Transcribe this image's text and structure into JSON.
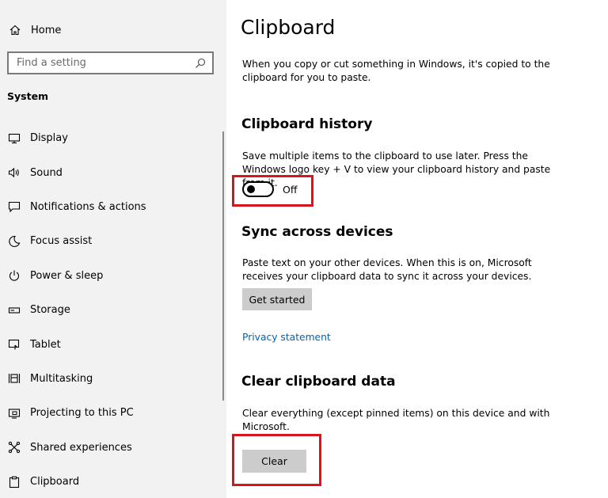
{
  "sidebar": {
    "home_label": "Home",
    "search_placeholder": "Find a setting",
    "section_label": "System",
    "items": [
      {
        "label": "Display",
        "icon": "display-icon"
      },
      {
        "label": "Sound",
        "icon": "speaker-icon"
      },
      {
        "label": "Notifications & actions",
        "icon": "notification-icon"
      },
      {
        "label": "Focus assist",
        "icon": "moon-icon"
      },
      {
        "label": "Power & sleep",
        "icon": "power-icon"
      },
      {
        "label": "Storage",
        "icon": "storage-icon"
      },
      {
        "label": "Tablet",
        "icon": "tablet-icon"
      },
      {
        "label": "Multitasking",
        "icon": "multitasking-icon"
      },
      {
        "label": "Projecting to this PC",
        "icon": "projecting-icon"
      },
      {
        "label": "Shared experiences",
        "icon": "shared-icon"
      },
      {
        "label": "Clipboard",
        "icon": "clipboard-icon"
      }
    ]
  },
  "main": {
    "title": "Clipboard",
    "intro": "When you copy or cut something in Windows, it's copied to the clipboard for you to paste.",
    "history": {
      "heading": "Clipboard history",
      "description": "Save multiple items to the clipboard to use later. Press the Windows logo key + V to view your clipboard history and paste from it.",
      "toggle_state": "Off"
    },
    "sync": {
      "heading": "Sync across devices",
      "description": "Paste text on your other devices. When this is on, Microsoft receives your clipboard data to sync it across your devices.",
      "button_label": "Get started"
    },
    "privacy_link": "Privacy statement",
    "clear": {
      "heading": "Clear clipboard data",
      "description": "Clear everything (except pinned items) on this device and with Microsoft.",
      "button_label": "Clear"
    }
  },
  "colors": {
    "sidebar_bg": "#f2f2f2",
    "link": "#0063b1",
    "highlight": "#d6151d",
    "button_bg": "#cccccc"
  }
}
